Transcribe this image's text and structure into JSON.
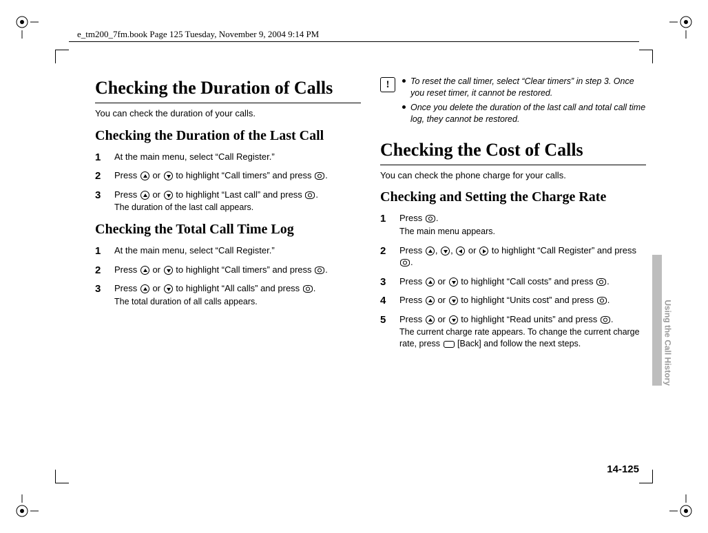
{
  "page_info_header": "e_tm200_7fm.book  Page 125  Tuesday, November 9, 2004  9:14 PM",
  "left": {
    "h1": "Checking the Duration of Calls",
    "intro": "You can check the duration of your calls.",
    "h2a": "Checking the Duration of the Last Call",
    "a1": "At the main menu, select “Call Register.”",
    "a2_pre": "Press ",
    "a2_mid": " or ",
    "a2_post1": " to highlight “Call timers” and press ",
    "a2_end": ".",
    "a3_pre": "Press ",
    "a3_mid": " or ",
    "a3_post1": " to highlight “Last call” and press ",
    "a3_end": ".",
    "a3_note": "The duration of the last call appears.",
    "h2b": "Checking the Total Call Time Log",
    "b1": "At the main menu, select “Call Register.”",
    "b2_pre": "Press ",
    "b2_mid": " or ",
    "b2_post1": " to highlight “Call timers” and press ",
    "b2_end": ".",
    "b3_pre": "Press ",
    "b3_mid": " or ",
    "b3_post1": " to highlight “All calls” and press ",
    "b3_end": ".",
    "b3_note": "The total duration of all calls appears."
  },
  "right": {
    "warn1": "To reset the call timer, select “Clear timers” in step 3. Once you reset timer, it cannot be restored.",
    "warn2": "Once you delete the duration of the last call and total call time log, they cannot be restored.",
    "h1": "Checking the Cost of Calls",
    "intro": "You can check the phone charge for your calls.",
    "h2": "Checking and Setting the Charge Rate",
    "c1_pre": "Press ",
    "c1_end": ".",
    "c1_note": "The main menu appears.",
    "c2_pre": "Press ",
    "c2_sep": ", ",
    "c2_mid": " or ",
    "c2_post": " to highlight “Call Register” and press ",
    "c2_end": ".",
    "c3_pre": "Press ",
    "c3_mid": " or ",
    "c3_post": " to highlight “Call costs” and press ",
    "c3_end": ".",
    "c4_pre": "Press ",
    "c4_mid": " or ",
    "c4_post": " to highlight “Units cost” and press ",
    "c4_end": ".",
    "c5_pre": "Press ",
    "c5_mid": " or ",
    "c5_post": " to highlight “Read units” and press ",
    "c5_end": ".",
    "c5_note_pre": "The current charge rate appears. To change the current charge rate, press ",
    "c5_note_post": " [Back] and follow the next steps."
  },
  "side_text": "Using the Call History",
  "page_num": "14-125"
}
